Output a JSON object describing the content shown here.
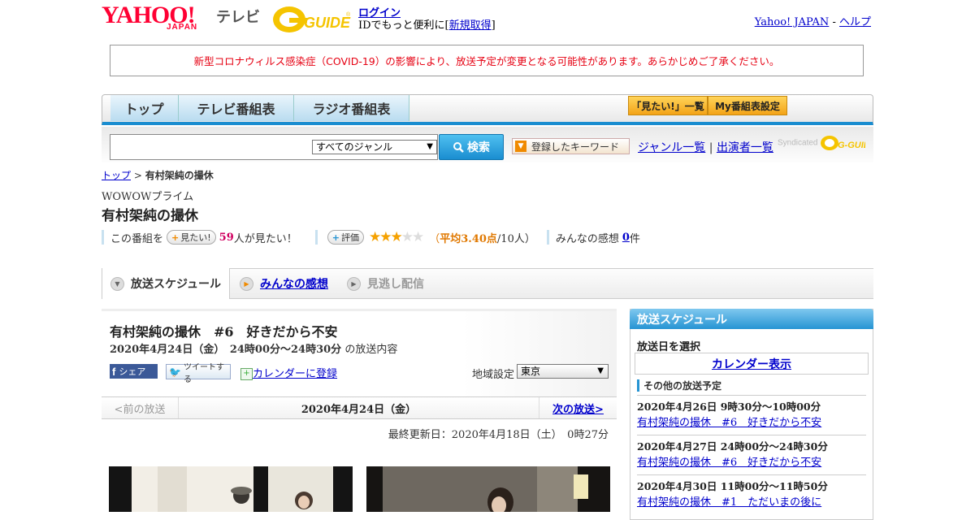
{
  "header": {
    "logo_yahoo": "YAHOO!",
    "logo_japan": "JAPAN",
    "logo_tv": "テレビ",
    "gguide_logo": "G-GUIDE",
    "login": "ログイン",
    "login_prefix": "IDでもっと便利に[",
    "signup": "新規取得",
    "login_suffix": "]",
    "yahoo_japan_link": "Yahoo! JAPAN",
    "separator": " - ",
    "help_link": "ヘルプ"
  },
  "notice": "新型コロナウィルス感染症（COVID-19）の影響により、放送予定が変更となる可能性があります。あらかじめご了承ください。",
  "nav": {
    "tabs": [
      "トップ",
      "テレビ番組表",
      "ラジオ番組表"
    ],
    "watchlist_button": "「見たい!」一覧",
    "my_schedule_button": "My番組表設定"
  },
  "search": {
    "genre_selected": "すべてのジャンル",
    "search_button": "検索",
    "keyword_button": "登録したキーワード",
    "genre_list_link": "ジャンル一覧",
    "divider": "|",
    "performer_list_link": "出演者一覧",
    "syndicated": "Syndicated",
    "gguide_small": "G-GUIDE"
  },
  "breadcrumb": {
    "top": "トップ",
    "sep": " > ",
    "current": "有村架純の撮休"
  },
  "program": {
    "channel": "WOWOWプライム",
    "title": "有村架純の撮休",
    "want_prefix": "この番組を",
    "want_button": "見たい!",
    "want_count": "59",
    "want_suffix": "人が見たい！",
    "rate_button": "評価",
    "rating_fraction": 0.68,
    "avg_prefix": "（",
    "avg_label": "平均3.40点",
    "avg_suffix": "/10人）",
    "impressions_label": "みんなの感想",
    "impressions_count": "0",
    "impressions_suffix": "件"
  },
  "tabs": {
    "schedule": "放送スケジュール",
    "reviews": "みんなの感想",
    "catchup": "見逃し配信"
  },
  "episode": {
    "title": "有村架純の撮休　#6　好きだから不安",
    "datetime": "2020年4月24日（金）　24時00分～24時30分",
    "datetime_suffix": "の放送内容",
    "share_button": "シェア",
    "tweet_button": "ツイートする",
    "calendar_register": "カレンダーに登録",
    "region_label": "地域設定",
    "region_selected": "東京"
  },
  "pager": {
    "prev": "<前の放送",
    "date": "2020年4月24日（金）",
    "next": "次の放送>"
  },
  "updated": "最終更新日：2020年4月18日（土）　0時27分",
  "sidebar": {
    "heading": "放送スケジュール",
    "select_date": "放送日を選択",
    "calendar_link": "カレンダー表示",
    "other_title": "その他の放送予定",
    "broadcasts": [
      {
        "date": "2020年4月26日  9時30分～10時00分",
        "title": "有村架純の撮休　#6　好きだから不安"
      },
      {
        "date": "2020年4月27日  24時00分～24時30分",
        "title": "有村架純の撮休　#6　好きだから不安"
      },
      {
        "date": "2020年4月30日  11時00分～11時50分",
        "title": "有村架純の撮休　#1　ただいまの後に"
      }
    ]
  },
  "colors": {
    "yahoo_red": "#ff0033",
    "accent_blue": "#1a8dd0",
    "notice_red": "#e60012",
    "link_blue": "#0000cc",
    "star_gold": "#f5a100"
  }
}
